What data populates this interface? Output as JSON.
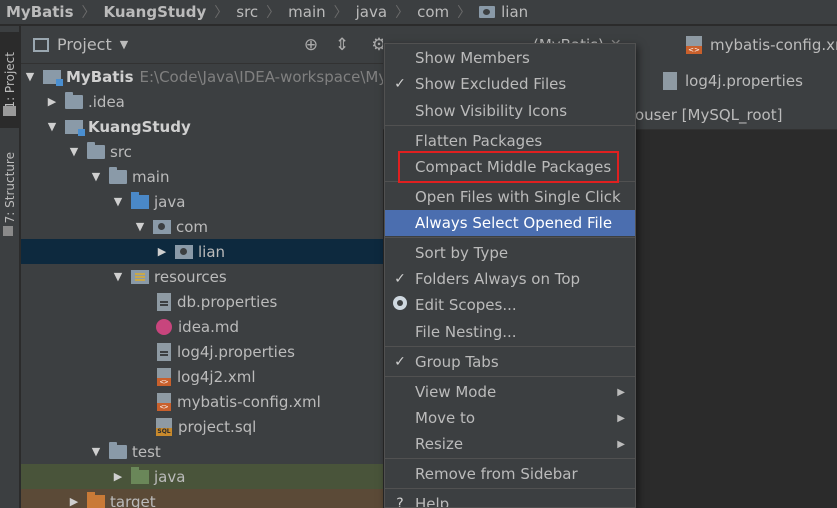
{
  "breadcrumb": [
    "MyBatis",
    "KuangStudy",
    "src",
    "main",
    "java",
    "com",
    "lian"
  ],
  "toolstrip": {
    "project_tab": "1: Project",
    "structure_tab": "7: Structure"
  },
  "project_panel": {
    "title": "Project",
    "tree": [
      {
        "label": "MyBatis",
        "hint": "E:\\Code\\Java\\IDEA-workspace\\My",
        "icon": "module-icon",
        "arrow": "▼"
      },
      {
        "label": ".idea",
        "icon": "folder-icon",
        "arrow": "▶"
      },
      {
        "label": "KuangStudy",
        "icon": "module-icon",
        "arrow": "▼"
      },
      {
        "label": "src",
        "icon": "folder-icon",
        "arrow": "▼"
      },
      {
        "label": "main",
        "icon": "folder-icon",
        "arrow": "▼"
      },
      {
        "label": "java",
        "icon": "source-folder-icon",
        "arrow": "▼"
      },
      {
        "label": "com",
        "icon": "package-icon",
        "arrow": "▼"
      },
      {
        "label": "lian",
        "icon": "package-icon",
        "arrow": "▶"
      },
      {
        "label": "resources",
        "icon": "resources-folder-icon",
        "arrow": "▼"
      },
      {
        "label": "db.properties",
        "icon": "properties-file-icon"
      },
      {
        "label": "idea.md",
        "icon": "markdown-file-icon"
      },
      {
        "label": "log4j.properties",
        "icon": "properties-file-icon"
      },
      {
        "label": "log4j2.xml",
        "icon": "xml-file-icon"
      },
      {
        "label": "mybatis-config.xml",
        "icon": "xml-file-icon"
      },
      {
        "label": "project.sql",
        "icon": "sql-file-icon"
      },
      {
        "label": "test",
        "icon": "folder-icon",
        "arrow": "▼"
      },
      {
        "label": "java",
        "icon": "test-folder-icon",
        "arrow": "▶"
      },
      {
        "label": "target",
        "icon": "target-folder-icon",
        "arrow": "▶"
      }
    ]
  },
  "editor_tabs": {
    "tab1": "mybatis-config.xm",
    "tab2": "log4j.properties",
    "tab3_partial": "(MyBatis)",
    "datasource": "ouser [MySQL_root]"
  },
  "menu": {
    "items": [
      {
        "label": "Show Members",
        "check": ""
      },
      {
        "label": "Show Excluded Files",
        "check": "✓"
      },
      {
        "label": "Show Visibility Icons",
        "check": ""
      },
      {
        "label": "Flatten Packages",
        "check": ""
      },
      {
        "label": "Compact Middle Packages",
        "check": ""
      },
      {
        "label": "Open Files with Single Click",
        "check": ""
      },
      {
        "label": "Always Select Opened File",
        "check": ""
      },
      {
        "label": "Sort by Type",
        "check": ""
      },
      {
        "label": "Folders Always on Top",
        "check": "✓"
      },
      {
        "label": "Edit Scopes...",
        "check": ""
      },
      {
        "label": "File Nesting...",
        "check": ""
      },
      {
        "label": "Group Tabs",
        "check": "✓"
      },
      {
        "label": "View Mode",
        "check": ""
      },
      {
        "label": "Move to",
        "check": ""
      },
      {
        "label": "Resize",
        "check": ""
      },
      {
        "label": "Remove from Sidebar",
        "check": ""
      },
      {
        "label": "Help",
        "check": "?"
      }
    ]
  },
  "colors": {
    "menu_highlight": "#4b6eaf",
    "annotation_red": "#e02020",
    "panel_bg": "#3c3f41",
    "editor_bg": "#2b2b2b",
    "selected_row": "#0d293e"
  }
}
